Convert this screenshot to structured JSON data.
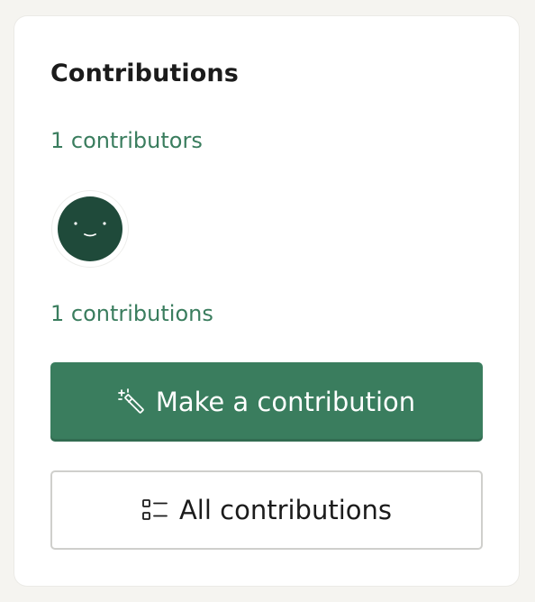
{
  "panel": {
    "title": "Contributions",
    "contributors_link": "1 contributors",
    "contributions_link": "1 contributions"
  },
  "avatar": {
    "icon": "smiley-face-icon",
    "background": "#1f4a3a"
  },
  "buttons": {
    "primary": {
      "label": "Make a contribution",
      "icon": "magic-wand-icon"
    },
    "secondary": {
      "label": "All contributions",
      "icon": "list-icon"
    }
  },
  "colors": {
    "accent": "#3a7d5e",
    "page_background": "#f5f4f0",
    "card_background": "#ffffff",
    "text": "#1b1b1b"
  }
}
